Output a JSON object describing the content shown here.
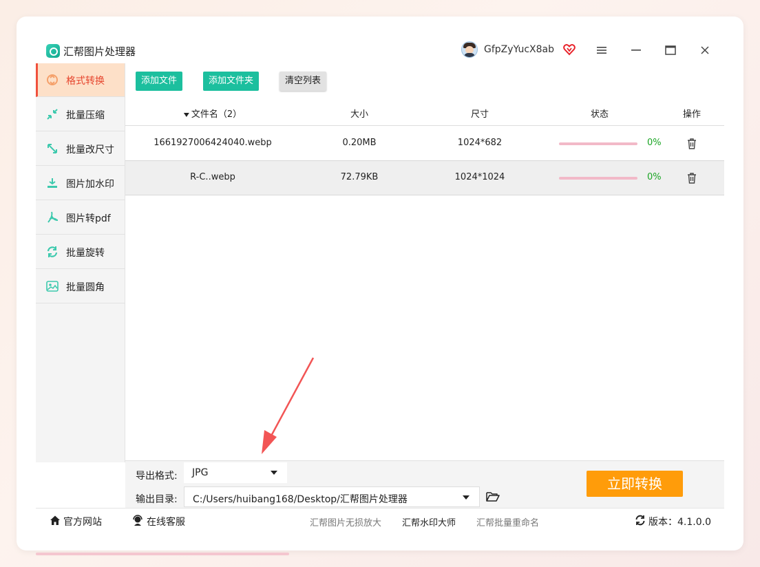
{
  "app": {
    "title": "汇帮图片处理器",
    "username": "GfpZyYucX8ab"
  },
  "window_controls": {
    "menu": "≡",
    "minimize": "—",
    "maximize": "☐",
    "close": "✕"
  },
  "sidebar": {
    "items": [
      {
        "label": "格式转换",
        "icon": "format-convert-icon",
        "active": true
      },
      {
        "label": "批量压缩",
        "icon": "compress-icon"
      },
      {
        "label": "批量改尺寸",
        "icon": "resize-icon"
      },
      {
        "label": "图片加水印",
        "icon": "watermark-icon"
      },
      {
        "label": "图片转pdf",
        "icon": "pdf-icon"
      },
      {
        "label": "批量旋转",
        "icon": "rotate-icon"
      },
      {
        "label": "批量圆角",
        "icon": "rounded-corner-icon"
      }
    ]
  },
  "toolbar": {
    "add_file": "添加文件",
    "add_folder": "添加文件夹",
    "clear_list": "清空列表"
  },
  "table": {
    "headers": {
      "name": "文件名（2）",
      "size": "大小",
      "dimensions": "尺寸",
      "status": "状态",
      "action": "操作"
    },
    "rows": [
      {
        "name": "1661927006424040.webp",
        "size": "0.20MB",
        "dimensions": "1024*682",
        "progress": 0,
        "percent": "0%"
      },
      {
        "name": "R-C..webp",
        "size": "72.79KB",
        "dimensions": "1024*1024",
        "progress": 0,
        "percent": "0%"
      }
    ]
  },
  "settings": {
    "format_label": "导出格式:",
    "format_value": "JPG",
    "output_label": "输出目录:",
    "output_value": "C:/Users/huibang168/Desktop/汇帮图片处理器",
    "convert_button": "立即转换"
  },
  "footer": {
    "website": "官方网站",
    "support": "在线客服",
    "link1": "汇帮图片无损放大",
    "link2": "汇帮水印大师",
    "link3": "汇帮批量重命名",
    "version": "版本：4.1.0.0"
  },
  "colors": {
    "accent_green": "#1cbf9e",
    "accent_orange": "#ff9c0a",
    "active_red": "#e6452d",
    "progress_pink": "#f2b9c8",
    "percent_green": "#1aa524"
  }
}
